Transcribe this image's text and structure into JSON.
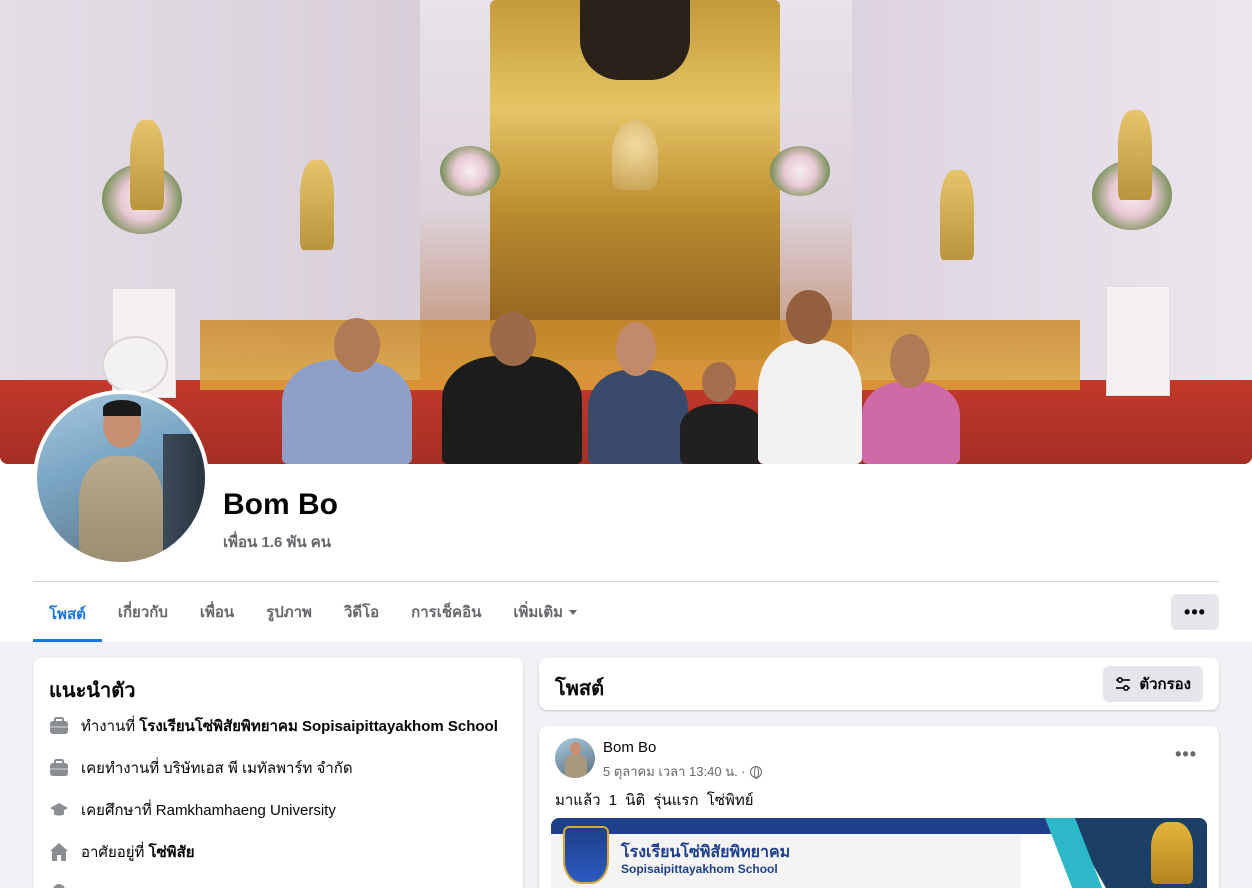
{
  "profile": {
    "name": "Bom Bo",
    "friends": "เพื่อน 1.6 พัน คน"
  },
  "tabs": [
    {
      "label": "โพสต์",
      "active": true
    },
    {
      "label": "เกี่ยวกับ",
      "active": false
    },
    {
      "label": "เพื่อน",
      "active": false
    },
    {
      "label": "รูปภาพ",
      "active": false
    },
    {
      "label": "วิดีโอ",
      "active": false
    },
    {
      "label": "การเช็คอิน",
      "active": false
    },
    {
      "label": "เพิ่มเติม",
      "active": false
    }
  ],
  "more_button": "•••",
  "intro": {
    "title": "แนะนำตัว",
    "items": [
      {
        "icon": "briefcase-icon",
        "prefix": "ทำงานที่",
        "value": "โรงเรียนโซ่พิสัยพิทยาคม Sopisaipittayakhom School",
        "bold": true
      },
      {
        "icon": "briefcase-icon",
        "prefix": "เคยทำงานที่",
        "value": "บริษัทเอส พี เมทัลพาร์ท จำกัด",
        "bold": false
      },
      {
        "icon": "graduation-cap-icon",
        "prefix": "เคยศึกษาที่",
        "value": "Ramkhamhaeng University",
        "bold": false
      },
      {
        "icon": "home-icon",
        "prefix": "อาศัยอยู่ที่",
        "value": "โซ่พิสัย",
        "bold": true
      }
    ]
  },
  "posts_header": {
    "title": "โพสต์",
    "filter_label": "ตัวกรอง"
  },
  "post": {
    "author": "Bom Bo",
    "meta": "5 ตุลาคม เวลา 13:40 น. ·",
    "dots": "•••",
    "text": "มาแล้ว 1 นิติ รุ่นแรก โซ่พิทย์",
    "banner_title": "โรงเรียนโซ่พิสัยพิทยาคม",
    "banner_subtitle": "Sopisaipittayakhom School"
  },
  "colors": {
    "accent": "#1b74e4",
    "background": "#f0f2f5",
    "secondary_text": "#65676b"
  }
}
